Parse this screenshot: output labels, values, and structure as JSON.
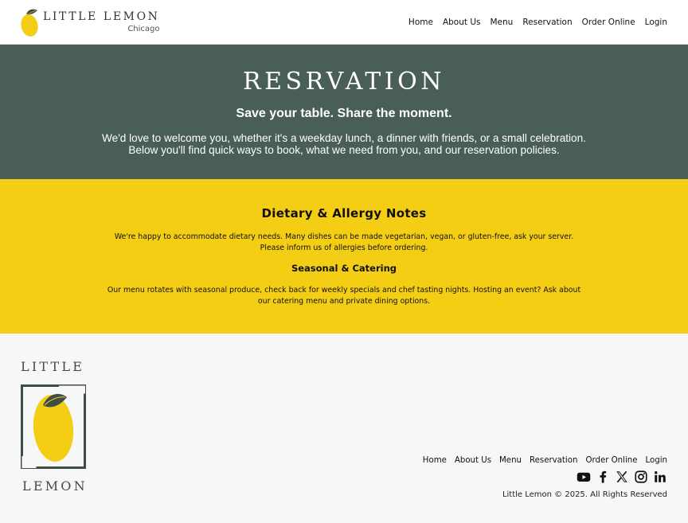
{
  "brand": {
    "name": "LITTLE LEMON",
    "city": "Chicago"
  },
  "nav": [
    "Home",
    "About Us",
    "Menu",
    "Reservation",
    "Order Online",
    "Login"
  ],
  "hero": {
    "title": "RESRVATION",
    "tagline": "Save your table. Share the moment.",
    "description_line1": "We'd love to welcome you, whether it's a weekday lunch, a dinner with friends, or a small celebration.",
    "description_line2": "Below you'll find quick ways to book, what we need from you, and our reservation policies."
  },
  "info": {
    "dietary_title": "Dietary & Allergy Notes",
    "dietary_line1": "We're happy to accommodate dietary needs. Many dishes can be made vegetarian, vegan, or gluten-free, ask your server.",
    "dietary_line2": "Please inform us of allergies before ordering.",
    "seasonal_title": "Seasonal & Catering",
    "seasonal_line1": "Our menu rotates with seasonal produce, check back for weekly specials and chef tasting nights. Hosting an event? Ask about",
    "seasonal_line2": "our catering menu and private dining options."
  },
  "footer": {
    "logo_top": "LITTLE",
    "logo_bottom": "LEMON",
    "nav": [
      "Home",
      "About Us",
      "Menu",
      "Reservation",
      "Order Online",
      "Login"
    ],
    "socials": [
      "youtube-icon",
      "facebook-icon",
      "x-icon",
      "instagram-icon",
      "linkedin-icon"
    ],
    "copyright": "Little Lemon © 2025. All Rights Reserved"
  },
  "colors": {
    "primary_green": "#495e57",
    "primary_yellow": "#f4ce14",
    "footer_bg": "#f7f7f7"
  }
}
